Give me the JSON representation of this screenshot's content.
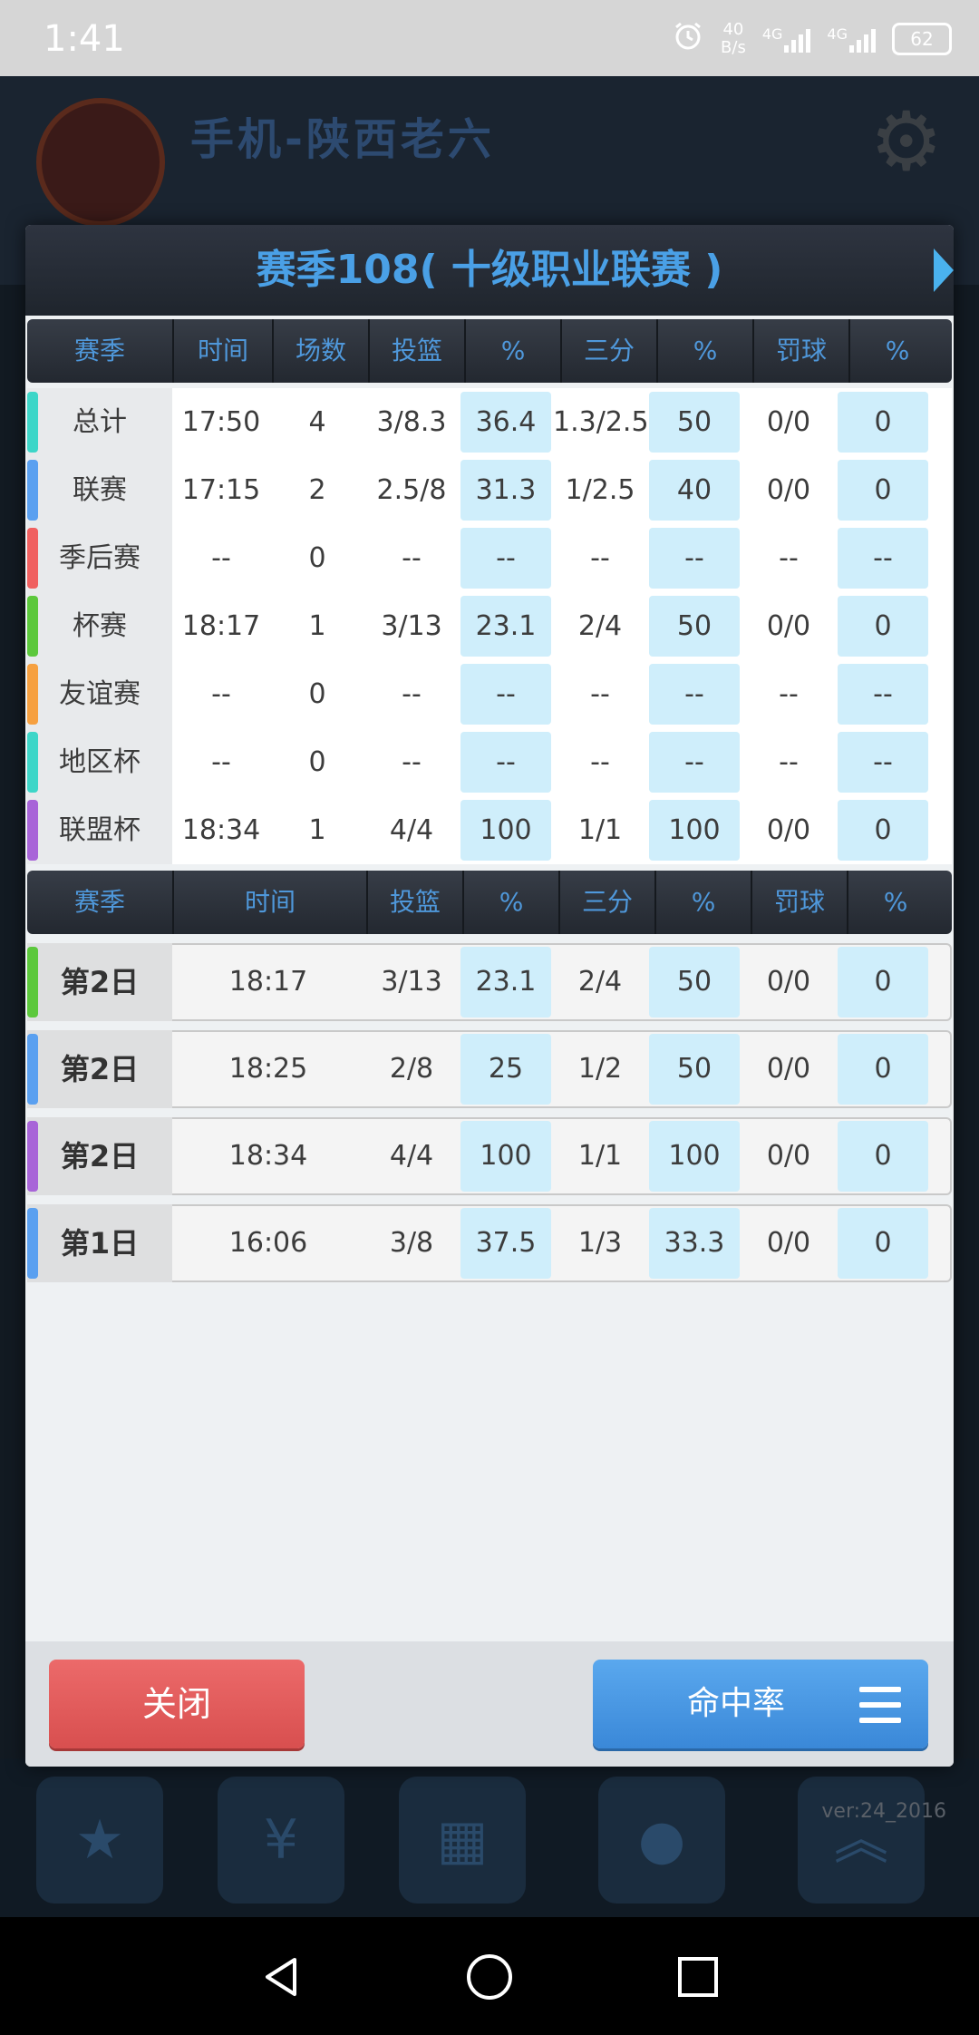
{
  "status_bar": {
    "time": "1:41",
    "net_speed_value": "40",
    "net_speed_unit": "B/s",
    "network_1": "4G",
    "network_2": "4G",
    "battery": "62"
  },
  "background": {
    "team_title": "手机-陕西老六",
    "version": "ver:24_2016"
  },
  "dialog": {
    "title": "赛季108( 十级职业联赛 )",
    "summary_headers": [
      "赛季",
      "时间",
      "场数",
      "投篮",
      "%",
      "三分",
      "%",
      "罚球",
      "%"
    ],
    "summary_rows": [
      {
        "label": "总计",
        "color": "#3dd6c8",
        "values": [
          "17:50",
          "4",
          "3/8.3",
          "36.4",
          "1.3/2.5",
          "50",
          "0/0",
          "0"
        ]
      },
      {
        "label": "联赛",
        "color": "#5aa0f0",
        "values": [
          "17:15",
          "2",
          "2.5/8",
          "31.3",
          "1/2.5",
          "40",
          "0/0",
          "0"
        ]
      },
      {
        "label": "季后赛",
        "color": "#f06060",
        "values": [
          "--",
          "0",
          "--",
          "--",
          "--",
          "--",
          "--",
          "--"
        ]
      },
      {
        "label": "杯赛",
        "color": "#5cc83c",
        "values": [
          "18:17",
          "1",
          "3/13",
          "23.1",
          "2/4",
          "50",
          "0/0",
          "0"
        ]
      },
      {
        "label": "友谊赛",
        "color": "#f6a040",
        "values": [
          "--",
          "0",
          "--",
          "--",
          "--",
          "--",
          "--",
          "--"
        ]
      },
      {
        "label": "地区杯",
        "color": "#3dd6c8",
        "values": [
          "--",
          "0",
          "--",
          "--",
          "--",
          "--",
          "--",
          "--"
        ]
      },
      {
        "label": "联盟杯",
        "color": "#a864d8",
        "values": [
          "18:34",
          "1",
          "4/4",
          "100",
          "1/1",
          "100",
          "0/0",
          "0"
        ]
      }
    ],
    "log_headers": [
      "赛季",
      "时间",
      "投篮",
      "%",
      "三分",
      "%",
      "罚球",
      "%"
    ],
    "log_rows": [
      {
        "label": "第2日",
        "color": "#5cc83c",
        "values": [
          "18:17",
          "3/13",
          "23.1",
          "2/4",
          "50",
          "0/0",
          "0"
        ]
      },
      {
        "label": "第2日",
        "color": "#5aa0f0",
        "values": [
          "18:25",
          "2/8",
          "25",
          "1/2",
          "50",
          "0/0",
          "0"
        ]
      },
      {
        "label": "第2日",
        "color": "#a864d8",
        "values": [
          "18:34",
          "4/4",
          "100",
          "1/1",
          "100",
          "0/0",
          "0"
        ]
      },
      {
        "label": "第1日",
        "color": "#5aa0f0",
        "values": [
          "16:06",
          "3/8",
          "37.5",
          "1/3",
          "33.3",
          "0/0",
          "0"
        ]
      }
    ],
    "close_label": "关闭",
    "rate_label": "命中率"
  }
}
